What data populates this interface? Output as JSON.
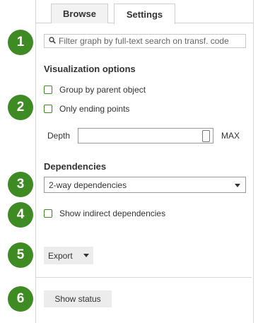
{
  "tabs": [
    {
      "label": "Browse",
      "active": false
    },
    {
      "label": "Settings",
      "active": true
    }
  ],
  "steps": [
    "1",
    "2",
    "3",
    "4",
    "5",
    "6"
  ],
  "search": {
    "placeholder": "Filter graph by full-text search on transf. code",
    "value": ""
  },
  "visualization": {
    "heading": "Visualization options",
    "group_by_parent": {
      "label": "Group by parent object",
      "checked": false
    },
    "only_ending_points": {
      "label": "Only ending points",
      "checked": false
    },
    "depth_label": "Depth",
    "depth_max_label": "MAX",
    "depth_level": 1.0
  },
  "dependencies": {
    "heading": "Dependencies",
    "selected": "2-way dependencies",
    "show_indirect": {
      "label": "Show indirect dependencies",
      "checked": false
    }
  },
  "export_button": {
    "label": "Export"
  },
  "status_button": {
    "label": "Show status"
  },
  "colors": {
    "accent": "#3d8b22"
  }
}
